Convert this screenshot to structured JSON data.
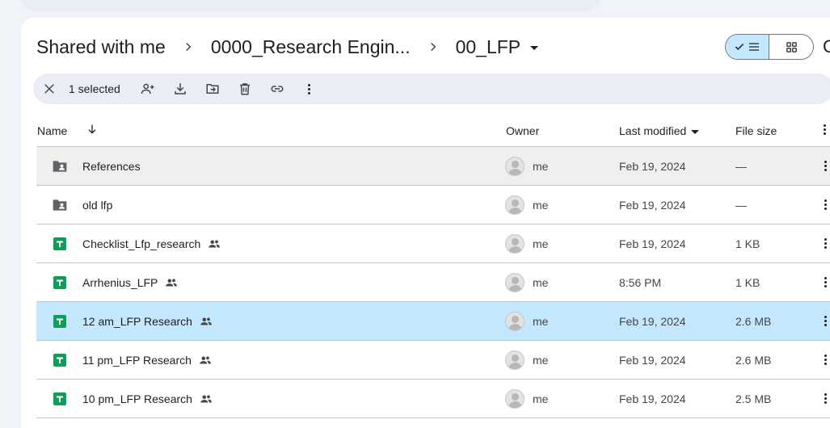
{
  "breadcrumb": {
    "items": [
      "Shared with me",
      "0000_Research Engin...",
      "00_LFP"
    ]
  },
  "view_toggle": {
    "list_icon": "check-list-icon",
    "grid_icon": "grid-icon"
  },
  "partial_header_text": "C",
  "toolbar": {
    "selected_label": "1 selected",
    "icons": [
      "close-icon",
      "share-person-icon",
      "download-icon",
      "move-to-folder-icon",
      "trash-icon",
      "link-icon",
      "more-vert-icon"
    ]
  },
  "table": {
    "columns": {
      "name": "Name",
      "owner": "Owner",
      "last_modified": "Last modified",
      "file_size": "File size"
    },
    "rows": [
      {
        "name": "References",
        "type": "shared-folder",
        "shared": false,
        "owner": "me",
        "modified": "Feb 19, 2024",
        "size": "—",
        "state": "hover"
      },
      {
        "name": "old lfp",
        "type": "shared-folder",
        "shared": false,
        "owner": "me",
        "modified": "Feb 19, 2024",
        "size": "—",
        "state": ""
      },
      {
        "name": "Checklist_Lfp_research",
        "type": "sheet",
        "shared": true,
        "owner": "me",
        "modified": "Feb 19, 2024",
        "size": "1 KB",
        "state": ""
      },
      {
        "name": "Arrhenius_LFP",
        "type": "sheet",
        "shared": true,
        "owner": "me",
        "modified": "8:56 PM",
        "size": "1 KB",
        "state": ""
      },
      {
        "name": "12 am_LFP Research",
        "type": "sheet",
        "shared": true,
        "owner": "me",
        "modified": "Feb 19, 2024",
        "size": "2.6 MB",
        "state": "selected"
      },
      {
        "name": "11 pm_LFP Research",
        "type": "sheet",
        "shared": true,
        "owner": "me",
        "modified": "Feb 19, 2024",
        "size": "2.6 MB",
        "state": ""
      },
      {
        "name": "10 pm_LFP Research",
        "type": "sheet",
        "shared": true,
        "owner": "me",
        "modified": "Feb 19, 2024",
        "size": "2.5 MB",
        "state": ""
      }
    ]
  },
  "colors": {
    "selected_row": "#c2e7ff",
    "hover_row": "#eff0ee",
    "sheets_green": "#0f9d58",
    "folder_gray": "#5f6368"
  }
}
